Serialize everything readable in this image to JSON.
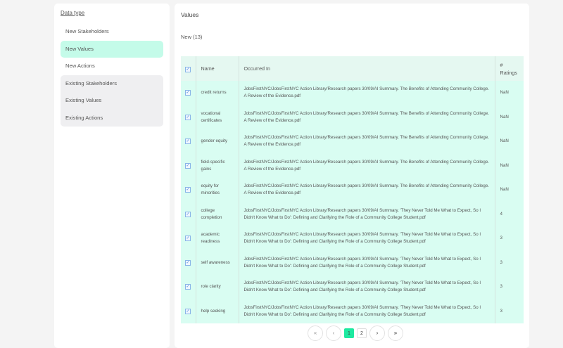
{
  "sidebar": {
    "heading": "Data type",
    "items": [
      {
        "label": "New Stakeholders"
      },
      {
        "label": "New Values"
      },
      {
        "label": "New Actions"
      },
      {
        "label": "Existing Stakeholders"
      },
      {
        "label": "Existing Values"
      },
      {
        "label": "Existing Actions"
      }
    ]
  },
  "main": {
    "title": "Values",
    "subtitle": "New (13)",
    "columns": [
      "Name",
      "Occurred In",
      "#\nRatings"
    ],
    "rows": [
      {
        "name": "credit returns",
        "occurred": "JobsFirstNYC/JobsFirstNYC Action Library/Research papers 30/09/AI Summary. The Benefits of Attending Community College. A Review of the Evidence.pdf",
        "ratings": "NaN"
      },
      {
        "name": "vocational certificates",
        "occurred": "JobsFirstNYC/JobsFirstNYC Action Library/Research papers 30/09/AI Summary. The Benefits of Attending Community College. A Review of the Evidence.pdf",
        "ratings": "NaN"
      },
      {
        "name": "gender equity",
        "occurred": "JobsFirstNYC/JobsFirstNYC Action Library/Research papers 30/09/AI Summary. The Benefits of Attending Community College. A Review of the Evidence.pdf",
        "ratings": "NaN"
      },
      {
        "name": "field-specific gains",
        "occurred": "JobsFirstNYC/JobsFirstNYC Action Library/Research papers 30/09/AI Summary. The Benefits of Attending Community College. A Review of the Evidence.pdf",
        "ratings": "NaN"
      },
      {
        "name": "equity for minorities",
        "occurred": "JobsFirstNYC/JobsFirstNYC Action Library/Research papers 30/09/AI Summary. The Benefits of Attending Community College. A Review of the Evidence.pdf",
        "ratings": "NaN"
      },
      {
        "name": "college completion",
        "occurred": "JobsFirstNYC/JobsFirstNYC Action Library/Research papers 30/09/AI Summary. 'They Never Told Me What to Expect, So I Didn't Know What to Do': Defining and Clarifying the Role of a Community College Student.pdf",
        "ratings": "4"
      },
      {
        "name": "academic readiness",
        "occurred": "JobsFirstNYC/JobsFirstNYC Action Library/Research papers 30/09/AI Summary. 'They Never Told Me What to Expect, So I Didn't Know What to Do': Defining and Clarifying the Role of a Community College Student.pdf",
        "ratings": "3"
      },
      {
        "name": "self awareness",
        "occurred": "JobsFirstNYC/JobsFirstNYC Action Library/Research papers 30/09/AI Summary. 'They Never Told Me What to Expect, So I Didn't Know What to Do': Defining and Clarifying the Role of a Community College Student.pdf",
        "ratings": "3"
      },
      {
        "name": "role clarity",
        "occurred": "JobsFirstNYC/JobsFirstNYC Action Library/Research papers 30/09/AI Summary. 'They Never Told Me What to Expect, So I Didn't Know What to Do': Defining and Clarifying the Role of a Community College Student.pdf",
        "ratings": "3"
      },
      {
        "name": "help seeking",
        "occurred": "JobsFirstNYC/JobsFirstNYC Action Library/Research papers 30/09/AI Summary. 'They Never Told Me What to Expect, So I Didn't Know What to Do': Defining and Clarifying the Role of a Community College Student.pdf",
        "ratings": "3"
      }
    ]
  },
  "pagination": {
    "first": "«",
    "prev": "‹",
    "pages": [
      "1",
      "2"
    ],
    "current": "1",
    "next": "›",
    "last": "»"
  }
}
